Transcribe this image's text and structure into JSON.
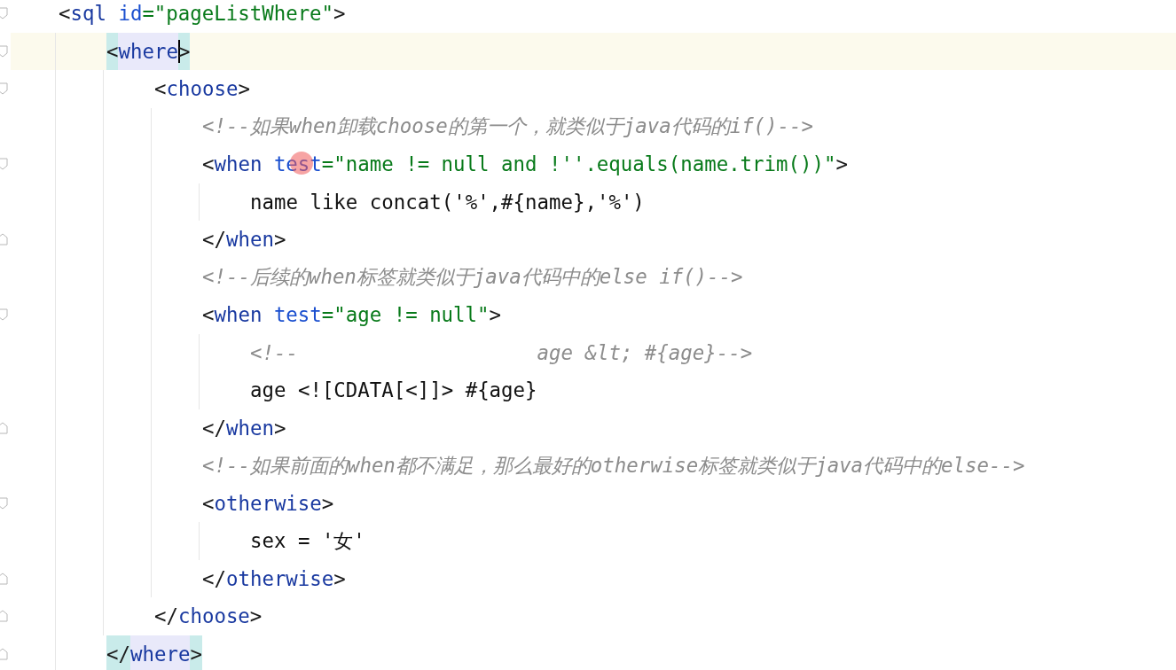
{
  "editor": {
    "lines": [
      {
        "fold_start": true,
        "fold_end": false,
        "current": false,
        "matched": false,
        "pointer": false,
        "tokens": [
          {
            "kind": "punct",
            "text": "<"
          },
          {
            "kind": "tag",
            "text": "sql"
          },
          {
            "kind": "attr",
            "text": " id"
          },
          {
            "kind": "value",
            "text": "=\"pageListWhere\""
          },
          {
            "kind": "punct",
            "text": ">"
          }
        ],
        "children": [
          {
            "fold_start": true,
            "fold_end": false,
            "current": true,
            "matched": true,
            "pointer": false,
            "tokens": [
              {
                "kind": "punct",
                "text": "<"
              },
              {
                "kind": "tag",
                "text": "where"
              },
              {
                "kind": "punct",
                "text": ">"
              }
            ],
            "children": [
              {
                "fold_start": true,
                "fold_end": false,
                "current": false,
                "matched": false,
                "pointer": false,
                "tokens": [
                  {
                    "kind": "punct",
                    "text": "<"
                  },
                  {
                    "kind": "tag",
                    "text": "choose"
                  },
                  {
                    "kind": "punct",
                    "text": ">"
                  }
                ],
                "children": [
                  {
                    "fold_start": false,
                    "fold_end": false,
                    "current": false,
                    "matched": false,
                    "pointer": false,
                    "tokens": [
                      {
                        "kind": "comment",
                        "text": "<!--如果when卸载choose的第一个，就类似于java代码的if()-->"
                      }
                    ]
                  },
                  {
                    "fold_start": true,
                    "fold_end": false,
                    "current": false,
                    "matched": false,
                    "pointer": true,
                    "tokens": [
                      {
                        "kind": "punct",
                        "text": "<"
                      },
                      {
                        "kind": "tag",
                        "text": "when"
                      },
                      {
                        "kind": "attr",
                        "text": " test"
                      },
                      {
                        "kind": "value",
                        "text": "=\"name != null and !''.equals(name.trim())\""
                      },
                      {
                        "kind": "punct",
                        "text": ">"
                      }
                    ],
                    "children": [
                      {
                        "fold_start": false,
                        "fold_end": false,
                        "current": false,
                        "matched": false,
                        "pointer": false,
                        "tokens": [
                          {
                            "kind": "text",
                            "text": "name like concat('%',#{name},'%')"
                          }
                        ]
                      }
                    ]
                  },
                  {
                    "fold_start": false,
                    "fold_end": true,
                    "current": false,
                    "matched": false,
                    "pointer": false,
                    "tokens": [
                      {
                        "kind": "punct",
                        "text": "</"
                      },
                      {
                        "kind": "tag",
                        "text": "when"
                      },
                      {
                        "kind": "punct",
                        "text": ">"
                      }
                    ]
                  },
                  {
                    "fold_start": false,
                    "fold_end": false,
                    "current": false,
                    "matched": false,
                    "pointer": false,
                    "tokens": [
                      {
                        "kind": "comment",
                        "text": "<!--后续的when标签就类似于java代码中的else if()-->"
                      }
                    ]
                  },
                  {
                    "fold_start": true,
                    "fold_end": false,
                    "current": false,
                    "matched": false,
                    "pointer": false,
                    "tokens": [
                      {
                        "kind": "punct",
                        "text": "<"
                      },
                      {
                        "kind": "tag",
                        "text": "when"
                      },
                      {
                        "kind": "attr",
                        "text": " test"
                      },
                      {
                        "kind": "value",
                        "text": "=\"age != null\""
                      },
                      {
                        "kind": "punct",
                        "text": ">"
                      }
                    ],
                    "children": [
                      {
                        "fold_start": false,
                        "fold_end": false,
                        "current": false,
                        "matched": false,
                        "pointer": false,
                        "tokens": [
                          {
                            "kind": "comment",
                            "text": "<!--                    age &lt; #{age}-->"
                          }
                        ]
                      },
                      {
                        "fold_start": false,
                        "fold_end": false,
                        "current": false,
                        "matched": false,
                        "pointer": false,
                        "tokens": [
                          {
                            "kind": "text",
                            "text": "age <![CDATA[<]]> #{age}"
                          }
                        ]
                      }
                    ]
                  },
                  {
                    "fold_start": false,
                    "fold_end": true,
                    "current": false,
                    "matched": false,
                    "pointer": false,
                    "tokens": [
                      {
                        "kind": "punct",
                        "text": "</"
                      },
                      {
                        "kind": "tag",
                        "text": "when"
                      },
                      {
                        "kind": "punct",
                        "text": ">"
                      }
                    ]
                  },
                  {
                    "fold_start": false,
                    "fold_end": false,
                    "current": false,
                    "matched": false,
                    "pointer": false,
                    "tokens": [
                      {
                        "kind": "comment",
                        "text": "<!--如果前面的when都不满足，那么最好的otherwise标签就类似于java代码中的else-->"
                      }
                    ]
                  },
                  {
                    "fold_start": true,
                    "fold_end": false,
                    "current": false,
                    "matched": false,
                    "pointer": false,
                    "tokens": [
                      {
                        "kind": "punct",
                        "text": "<"
                      },
                      {
                        "kind": "tag",
                        "text": "otherwise"
                      },
                      {
                        "kind": "punct",
                        "text": ">"
                      }
                    ],
                    "children": [
                      {
                        "fold_start": false,
                        "fold_end": false,
                        "current": false,
                        "matched": false,
                        "pointer": false,
                        "tokens": [
                          {
                            "kind": "text",
                            "text": "sex = '女'"
                          }
                        ]
                      }
                    ]
                  },
                  {
                    "fold_start": false,
                    "fold_end": true,
                    "current": false,
                    "matched": false,
                    "pointer": false,
                    "tokens": [
                      {
                        "kind": "punct",
                        "text": "</"
                      },
                      {
                        "kind": "tag",
                        "text": "otherwise"
                      },
                      {
                        "kind": "punct",
                        "text": ">"
                      }
                    ]
                  }
                ]
              },
              {
                "fold_start": false,
                "fold_end": true,
                "current": false,
                "matched": false,
                "pointer": false,
                "tokens": [
                  {
                    "kind": "punct",
                    "text": "</"
                  },
                  {
                    "kind": "tag",
                    "text": "choose"
                  },
                  {
                    "kind": "punct",
                    "text": ">"
                  }
                ]
              }
            ]
          },
          {
            "fold_start": false,
            "fold_end": true,
            "current": false,
            "matched": true,
            "pointer": false,
            "tokens": [
              {
                "kind": "punct",
                "text": "</"
              },
              {
                "kind": "tag",
                "text": "where"
              },
              {
                "kind": "punct",
                "text": ">"
              }
            ]
          }
        ]
      }
    ]
  }
}
